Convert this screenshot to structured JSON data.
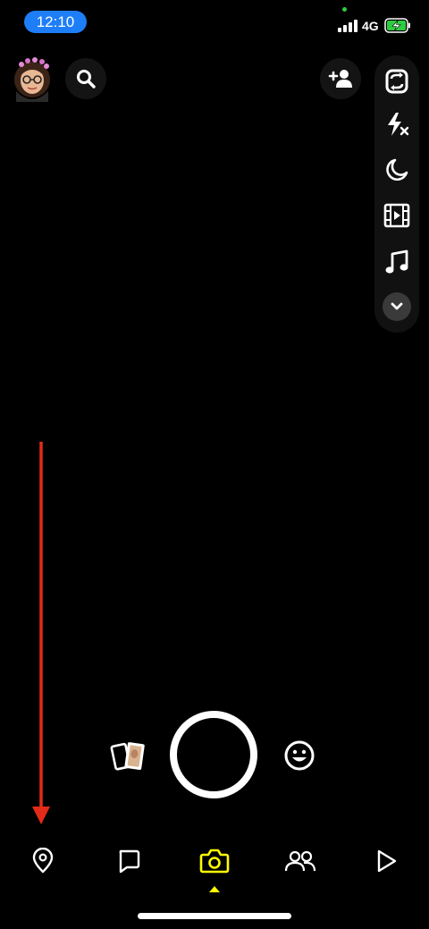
{
  "status_bar": {
    "time": "12:10",
    "network": "4G",
    "time_pill_color": "#1e7ef7",
    "battery_color": "#2ecc40"
  },
  "top_bar": {
    "avatar_icon": "bitmoji-avatar",
    "search_icon": "search-icon",
    "add_friend_icon": "add-friend-icon"
  },
  "camera_tools": [
    {
      "icon": "flip-camera-icon"
    },
    {
      "icon": "flash-off-icon"
    },
    {
      "icon": "night-mode-icon"
    },
    {
      "icon": "video-film-icon"
    },
    {
      "icon": "music-icon"
    },
    {
      "icon": "chevron-down-icon"
    }
  ],
  "capture_row": {
    "memories_icon": "memories-icon",
    "shutter": "shutter-button",
    "lens_icon": "lens-smiley-icon"
  },
  "bottom_nav": {
    "items": [
      {
        "icon": "map-pin-icon",
        "active": false
      },
      {
        "icon": "chat-icon",
        "active": false
      },
      {
        "icon": "camera-icon",
        "active": true
      },
      {
        "icon": "friends-icon",
        "active": false
      },
      {
        "icon": "play-icon",
        "active": false
      }
    ],
    "active_color": "#fffc00"
  },
  "annotation": {
    "arrow_color": "#e32b19",
    "arrow_direction": "down"
  }
}
